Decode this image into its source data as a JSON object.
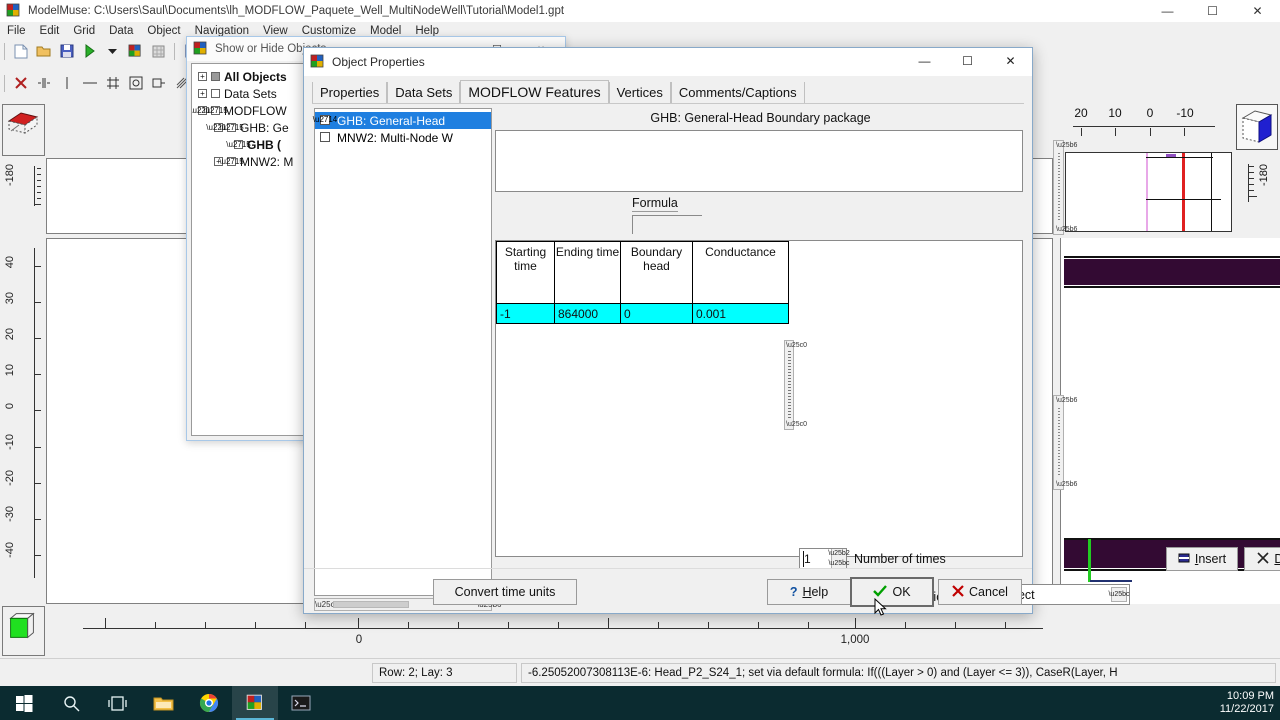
{
  "app": {
    "title": "ModelMuse: C:\\Users\\Saul\\Documents\\lh_MODFLOW_Paquete_Well_MultiNodeWell\\Tutorial\\Model1.gpt",
    "title_icon": "modelmuse-cube-icon",
    "window_buttons": {
      "minimize": "—",
      "maximize": "☐",
      "close": "✕"
    },
    "menu": [
      "File",
      "Edit",
      "Grid",
      "Data",
      "Object",
      "Navigation",
      "View",
      "Customize",
      "Model",
      "Help"
    ],
    "toolbar_row1": [
      "new-file-icon",
      "open-folder-icon",
      "save-icon",
      "run-icon",
      "dropdown-arrow-icon",
      "cube-color-icon",
      "grid-small-icon",
      "separator",
      "blue-tab-icon"
    ],
    "toolbar_row2": [
      "delete-x-icon",
      "align-icon",
      "line-icon",
      "minus-icon",
      "grid-icon",
      "box-icon",
      "measure-icon",
      "hatch-icon"
    ]
  },
  "rulers": {
    "left_top_label": "-180",
    "left_main_labels": [
      "40",
      "30",
      "20",
      "10",
      "0",
      "-10",
      "-20",
      "-30",
      "-40"
    ],
    "bottom_labels": [
      "0",
      "1,000"
    ],
    "right_top_labels": [
      "20",
      "10",
      "0",
      "-10"
    ],
    "right_side_label": "-180"
  },
  "viewcubes": {
    "top_left": "red-top-view-cube-icon",
    "bottom_left": "green-front-view-cube-icon",
    "right": "blue-side-view-cube-icon"
  },
  "statusbar": {
    "position": "Row: 2; Lay: 3",
    "formula": "-6.25052007308113E-6: Head_P2_S24_1; set via default formula: If(((Layer > 0) and (Layer <= 3)), CaseR(Layer, H"
  },
  "taskbar": {
    "items": [
      "start-windows-icon",
      "search-icon",
      "task-view-icon",
      "file-explorer-icon",
      "chrome-icon",
      "modelmuse-icon",
      "terminal-icon"
    ],
    "clock_time": "10:09 PM",
    "clock_date": "11/22/2017"
  },
  "show_hide_window": {
    "title": "Show or Hide Objects",
    "title_icon": "modelmuse-cube-icon",
    "window_buttons": {
      "maximize": "☐",
      "close": "∨"
    },
    "tree": [
      {
        "label": "All Objects",
        "box": "■",
        "bold": true,
        "indent": 0,
        "expander": "+"
      },
      {
        "label": "Data Sets",
        "box": "",
        "bold": false,
        "indent": 0,
        "expander": "+"
      },
      {
        "label": "MODFLOW",
        "box": "☒",
        "bold": false,
        "indent": 0,
        "expander": "-"
      },
      {
        "label": "GHB: Ge",
        "box": "☒",
        "bold": false,
        "indent": 1,
        "expander": "-"
      },
      {
        "label": "GHB (",
        "box": "☒",
        "bold": true,
        "indent": 2,
        "expander": ""
      },
      {
        "label": "MNW2: M",
        "box": "☒",
        "bold": false,
        "indent": 1,
        "expander": "+"
      }
    ]
  },
  "object_properties": {
    "title": "Object Properties",
    "title_icon": "modelmuse-cube-icon",
    "window_buttons": {
      "minimize": "—",
      "maximize": "☐",
      "close": "✕"
    },
    "tabs": [
      {
        "label": "Properties",
        "active": false
      },
      {
        "label": "Data Sets",
        "active": false
      },
      {
        "label": "MODFLOW Features",
        "active": true
      },
      {
        "label": "Vertices",
        "active": false
      },
      {
        "label": "Comments/Captions",
        "active": false
      }
    ],
    "feature_list": [
      {
        "label": "GHB: General-Head",
        "checked": true,
        "selected": true
      },
      {
        "label": "MNW2: Multi-Node W",
        "checked": false,
        "selected": false
      }
    ],
    "package_header": "GHB: General-Head Boundary package",
    "formula_label": "Formula",
    "formula_value": "",
    "table": {
      "columns": [
        "Starting time",
        "Ending time",
        "Boundary head",
        "Conductance"
      ],
      "rows": [
        [
          "-1",
          "864000",
          "0",
          "0.001"
        ]
      ]
    },
    "number_of_times_value": "1",
    "number_of_times_label": "Number of times",
    "insert_label": "Insert",
    "insert_label_underline": "I",
    "delete_label": "Delete",
    "delete_label_underline": "D",
    "conductance_label": "Conductance interpretation",
    "conductance_value": "Direct",
    "footer": {
      "convert_label": "Convert time units",
      "help_label": "Help",
      "help_underline": "H",
      "ok_label": "OK",
      "cancel_label": "Cancel"
    }
  },
  "colors": {
    "selection_blue": "#1f7fe0",
    "row_cyan": "#00ffff",
    "band_purple": "#330a33",
    "ok_check_green": "#00a000",
    "cancel_x_red": "#c00000",
    "taskbar": "#0b2b30"
  }
}
